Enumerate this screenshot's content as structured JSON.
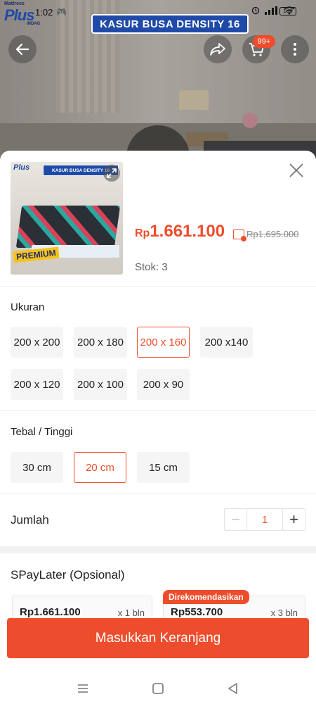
{
  "status_bar": {
    "brand_top": "Mattress",
    "brand_main": "Plus",
    "brand_sub": "INDAG",
    "time": "1:02",
    "battery": "100"
  },
  "banner": {
    "title": "KASUR BUSA DENSITY 16"
  },
  "top_actions": {
    "cart_badge": "99+"
  },
  "product": {
    "thumb_banner": "KASUR BUSA DENSITY 16",
    "thumb_logo": "Plus",
    "thumb_promo": "PREMIUM",
    "price_currency": "Rp",
    "price_amount": "1.661.100",
    "original_price": "Rp1.695.000",
    "stock": "Stok: 3"
  },
  "size": {
    "label": "Ukuran",
    "options": [
      "200 x 200",
      "200 x 180",
      "200 x 160",
      "200 x140",
      "200 x 120",
      "200 x 100",
      "200 x 90"
    ],
    "selected": "200 x 160"
  },
  "thickness": {
    "label": "Tebal / Tinggi",
    "options": [
      "30 cm",
      "20 cm",
      "15 cm"
    ],
    "selected": "20 cm"
  },
  "quantity": {
    "label": "Jumlah",
    "value": "1"
  },
  "paylater": {
    "label": "SPayLater (Opsional)",
    "recommend_badge": "Direkomendasikan",
    "plans": [
      {
        "amount": "Rp1.661.100",
        "tenor": "x 1 bln"
      },
      {
        "amount": "Rp553.700",
        "tenor": "x 3 bln"
      }
    ]
  },
  "cta": {
    "label": "Masukkan Keranjang"
  },
  "colors": {
    "accent": "#ee4d2d",
    "brand_blue": "#1f4aa8"
  },
  "icons": [
    "arrow-left-icon",
    "share-icon",
    "cart-icon",
    "more-vertical-icon",
    "close-icon",
    "expand-icon",
    "menu-icon",
    "home-square-icon",
    "back-triangle-icon"
  ]
}
